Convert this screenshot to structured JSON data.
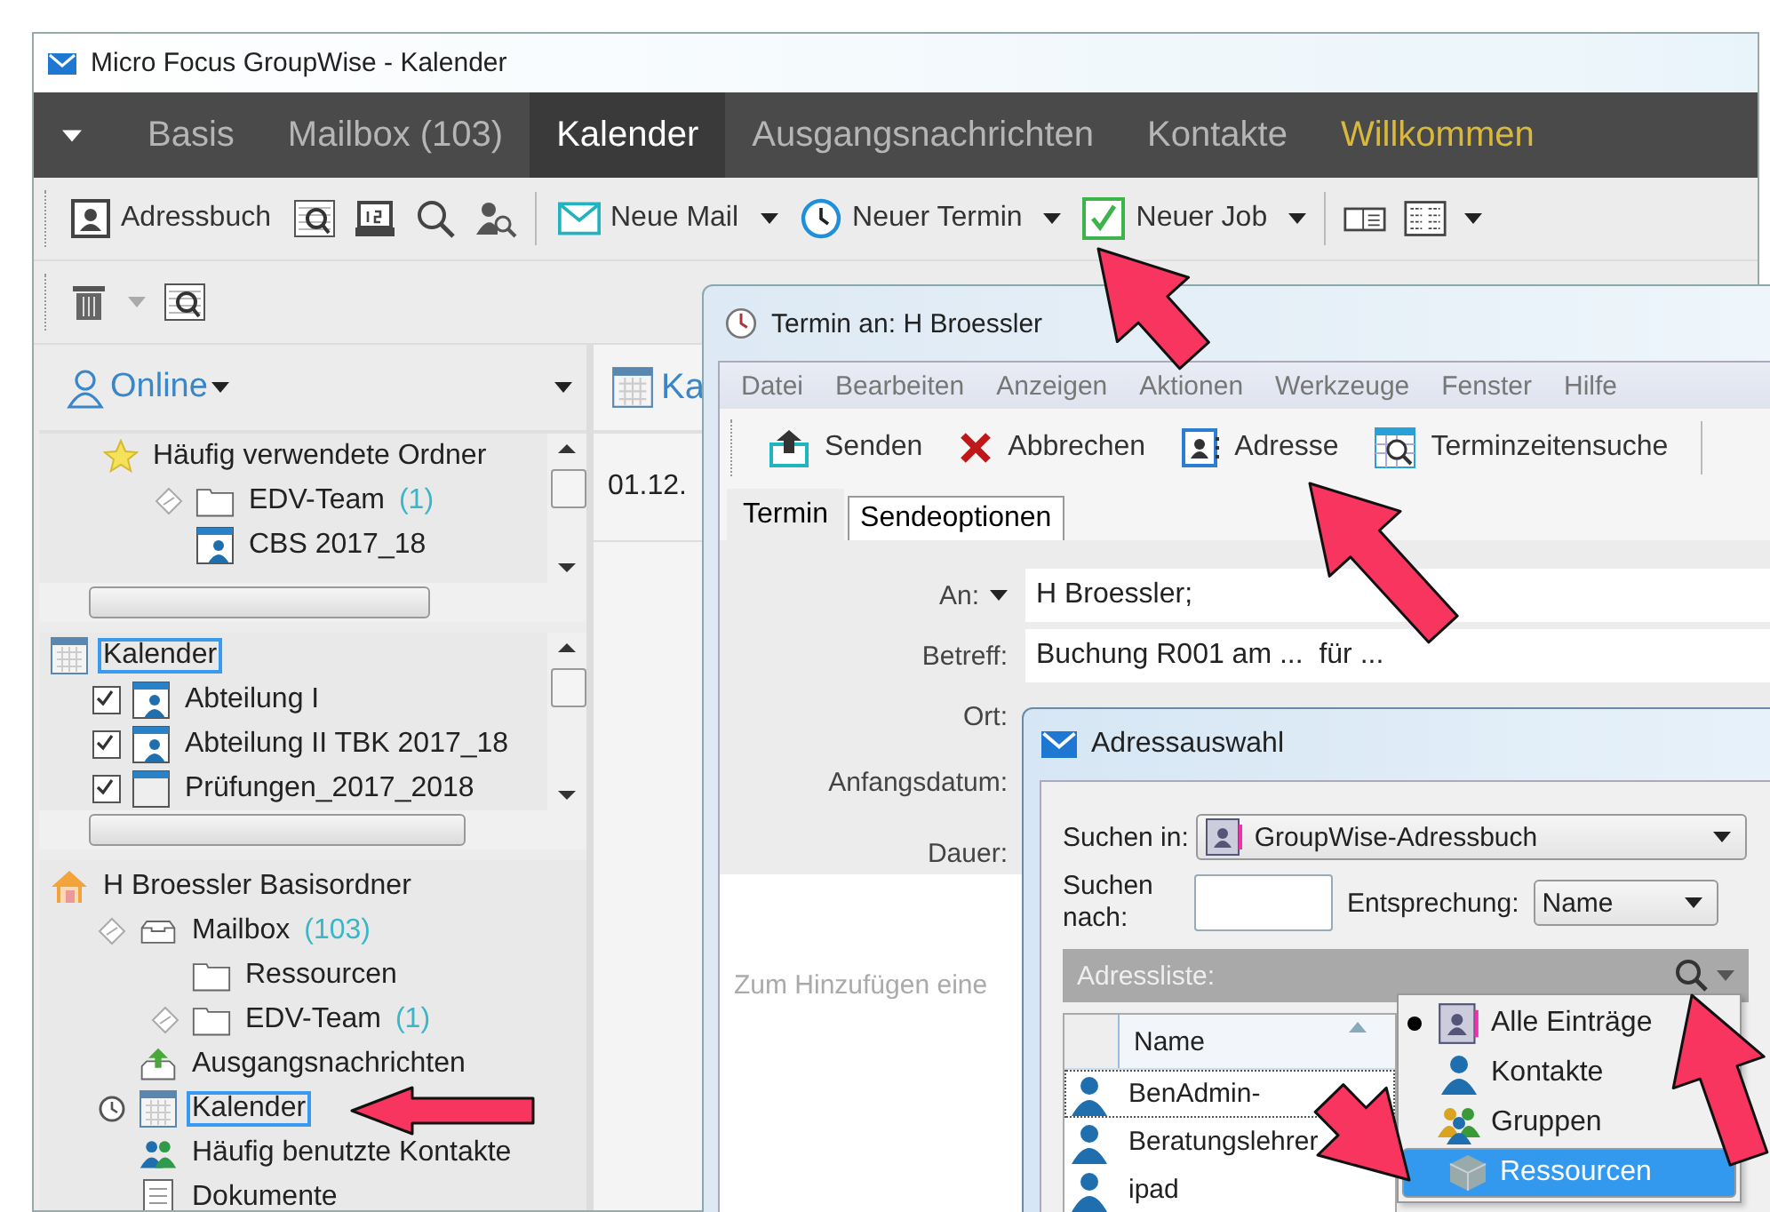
{
  "window": {
    "title": "Micro Focus GroupWise - Kalender"
  },
  "nav_tabs": [
    {
      "label": "Basis",
      "selected": false,
      "kind": "tab"
    },
    {
      "label": "Mailbox (103)",
      "selected": false,
      "kind": "tab"
    },
    {
      "label": "Kalender",
      "selected": true,
      "kind": "tab"
    },
    {
      "label": "Ausgangsnachrichten",
      "selected": false,
      "kind": "tab"
    },
    {
      "label": "Kontakte",
      "selected": false,
      "kind": "tab"
    },
    {
      "label": "Willkommen",
      "selected": false,
      "kind": "welcome"
    }
  ],
  "toolbar": {
    "buttons": [
      "Adressbuch",
      "Neue Mail",
      "Neuer Termin",
      "Neuer Job"
    ]
  },
  "sidebar": {
    "mode": "Online",
    "favorites": {
      "title": "Häufig verwendete Ordner",
      "items": [
        {
          "label": "EDV-Team",
          "count": "(1)",
          "kind": "folder",
          "marker": true
        },
        {
          "label": "CBS 2017_18",
          "kind": "shared-calendar",
          "marker": false
        }
      ]
    },
    "calendars": {
      "title": "Kalender",
      "focused": true,
      "items": [
        {
          "label": "Abteilung I",
          "checked": true,
          "kind": "shared-calendar"
        },
        {
          "label": "Abteilung II TBK 2017_18",
          "checked": true,
          "kind": "shared-calendar"
        },
        {
          "label": "Prüfungen_2017_2018",
          "checked": true,
          "kind": "calendar"
        }
      ]
    },
    "folders": {
      "title": "H Broessler Basisordner",
      "children": [
        {
          "label": "Mailbox",
          "count": "(103)",
          "kind": "mailbox",
          "marker": true,
          "selected": false,
          "children": [
            {
              "label": "Ressourcen",
              "kind": "folder",
              "marker": false,
              "selected": false
            },
            {
              "label": "EDV-Team",
              "count": "(1)",
              "kind": "folder",
              "marker": true,
              "selected": false
            }
          ]
        },
        {
          "label": "Ausgangsnachrichten",
          "kind": "outbox",
          "marker": false,
          "selected": false
        },
        {
          "label": "Kalender",
          "kind": "calendar",
          "marker": false,
          "selected": true
        },
        {
          "label": "Häufig benutzte Kontakte",
          "kind": "contacts",
          "marker": false,
          "selected": false
        },
        {
          "label": "Dokumente",
          "kind": "documents",
          "marker": false,
          "selected": false
        }
      ]
    }
  },
  "calendar_view": {
    "header": "Ka",
    "date": "01.12."
  },
  "appointment": {
    "title": "Termin an: H Broessler",
    "menu": [
      "Datei",
      "Bearbeiten",
      "Anzeigen",
      "Aktionen",
      "Werkzeuge",
      "Fenster",
      "Hilfe"
    ],
    "toolbar": [
      "Senden",
      "Abbrechen",
      "Adresse",
      "Terminzeitensuche"
    ],
    "tabs": [
      {
        "label": "Termin",
        "selected": true
      },
      {
        "label": "Sendeoptionen",
        "selected": false
      }
    ],
    "fields": [
      {
        "label": "An:",
        "value": "H Broessler;",
        "kind": "dropdown"
      },
      {
        "label": "Betreff:",
        "value": "Buchung R001 am ...  für ...",
        "kind": "text"
      },
      {
        "label": "Ort:",
        "kind": "text"
      },
      {
        "label": "Anfangsdatum:",
        "kind": "text"
      },
      {
        "label": "Dauer:",
        "kind": "text"
      }
    ],
    "hint": "Zum Hinzufügen eine"
  },
  "address_dialog": {
    "title": "Adressauswahl",
    "search_in_label": "Suchen in:",
    "search_in": "GroupWise-Adressbuch",
    "search_for_label": "Suchen nach:",
    "match_label": "Entsprechung:",
    "match": "Name",
    "list_label": "Adressliste:",
    "column": "Name",
    "rows": [
      "BenAdmin-",
      "Beratungslehrer",
      "ipad"
    ],
    "menu": [
      {
        "label": "Alle Einträge",
        "checked": true,
        "selected": false,
        "kind": "all"
      },
      {
        "label": "Kontakte",
        "checked": false,
        "selected": false,
        "kind": "contact"
      },
      {
        "label": "Gruppen",
        "checked": false,
        "selected": false,
        "kind": "group"
      },
      {
        "label": "Ressourcen",
        "checked": false,
        "selected": true,
        "kind": "resource"
      }
    ]
  }
}
